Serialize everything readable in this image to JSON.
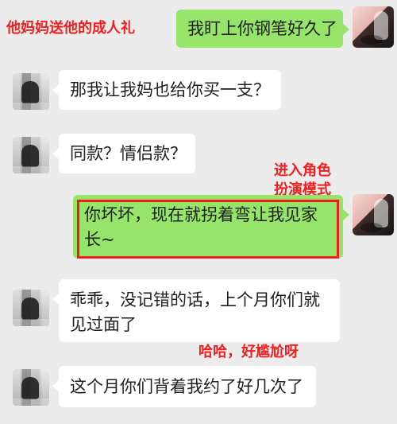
{
  "messages": [
    {
      "side": "right",
      "text": "我盯上你钢笔好久了"
    },
    {
      "side": "left",
      "text": "那我让我妈也给你买一支？"
    },
    {
      "side": "left",
      "text": "同款？情侣款？"
    },
    {
      "side": "right",
      "line1": "你坏坏，现在就拐着弯让我见家",
      "line2": "长~"
    },
    {
      "side": "left",
      "line1": "乖乖，没记错的话，上个月你们就",
      "line2": "见过面了"
    },
    {
      "side": "left",
      "text": "这个月你们背着我约了好几次了"
    }
  ],
  "annotations": {
    "top_left": "他妈妈送他的成人礼",
    "role_play_line1": "进入角色",
    "role_play_line2": "扮演模式",
    "awkward": "哈哈，好尴尬呀"
  },
  "colors": {
    "annotation": "#ef1f1f",
    "sent_bubble": "#96e469",
    "received_bubble": "#ffffff",
    "background": "#ececec"
  }
}
